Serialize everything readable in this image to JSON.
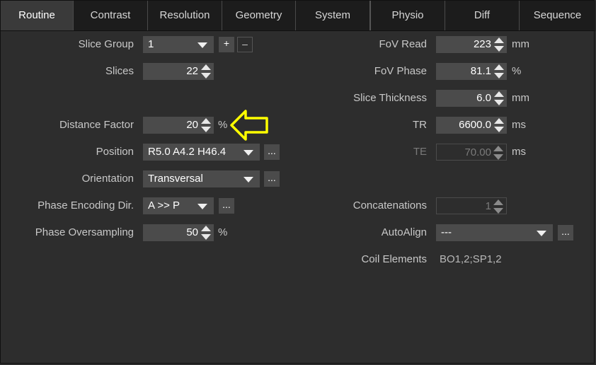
{
  "tabs": [
    {
      "label": "Routine",
      "active": true
    },
    {
      "label": "Contrast"
    },
    {
      "label": "Resolution"
    },
    {
      "label": "Geometry"
    },
    {
      "label": "System"
    },
    {
      "label": "Physio"
    },
    {
      "label": "Diff"
    },
    {
      "label": "Sequence"
    }
  ],
  "left": {
    "slice_group": {
      "label": "Slice Group",
      "value": "1",
      "plus": "+",
      "minus": "–"
    },
    "slices": {
      "label": "Slices",
      "value": "22"
    },
    "distance_factor": {
      "label": "Distance Factor",
      "value": "20",
      "unit": "%"
    },
    "position": {
      "label": "Position",
      "value": "R5.0 A4.2 H46.4",
      "more": "..."
    },
    "orientation": {
      "label": "Orientation",
      "value": "Transversal",
      "more": "..."
    },
    "phase_dir": {
      "label": "Phase Encoding Dir.",
      "value": "A >> P",
      "more": "..."
    },
    "phase_oversampling": {
      "label": "Phase Oversampling",
      "value": "50",
      "unit": "%"
    }
  },
  "right": {
    "fov_read": {
      "label": "FoV Read",
      "value": "223",
      "unit": "mm"
    },
    "fov_phase": {
      "label": "FoV Phase",
      "value": "81.1",
      "unit": "%"
    },
    "slice_thickness": {
      "label": "Slice Thickness",
      "value": "6.0",
      "unit": "mm"
    },
    "tr": {
      "label": "TR",
      "value": "6600.0",
      "unit": "ms"
    },
    "te": {
      "label": "TE",
      "value": "70.00",
      "unit": "ms"
    },
    "concatenations": {
      "label": "Concatenations",
      "value": "1"
    },
    "autoalign": {
      "label": "AutoAlign",
      "value": "---",
      "more": "..."
    },
    "coil_elements": {
      "label": "Coil Elements",
      "value": "BO1,2;SP1,2"
    }
  },
  "colors": {
    "background": "#2d2d2d",
    "field": "#4b4b4b",
    "highlight_arrow": "#ffff00"
  }
}
